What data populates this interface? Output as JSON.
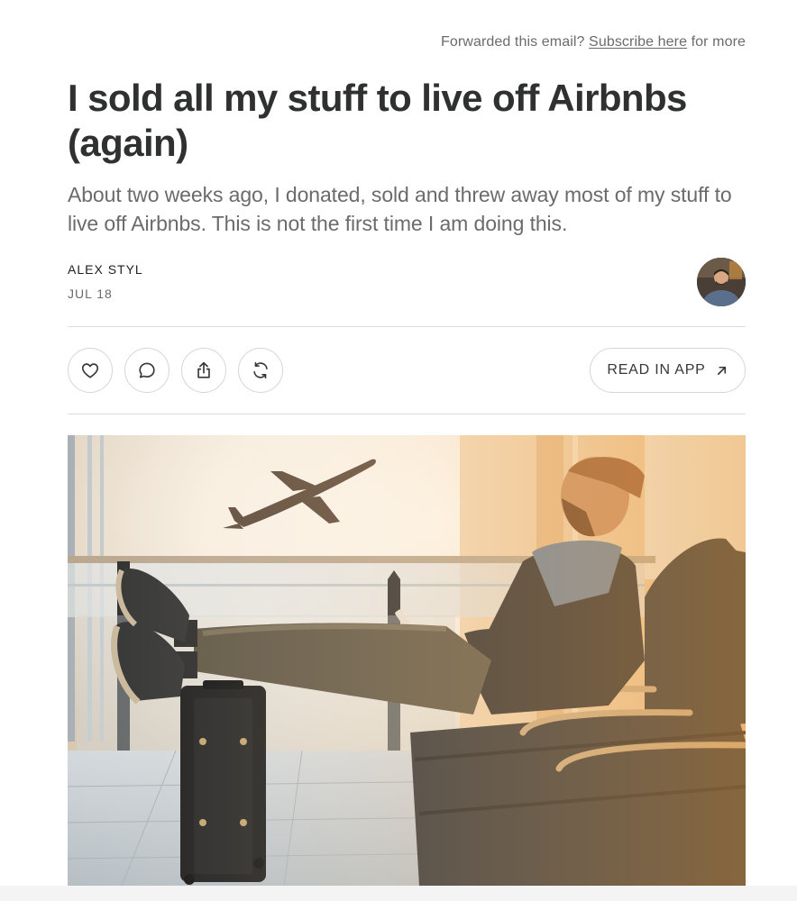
{
  "header": {
    "forward_prefix": "Forwarded this email?",
    "subscribe_link": "Subscribe here",
    "forward_suffix": "for more"
  },
  "post": {
    "title": "I sold all my stuff to live off Airbnbs (again)",
    "subtitle": "About two weeks ago, I donated, sold and threw away most of my stuff to live off Airbnbs. This is not the first time I am doing this.",
    "author": "ALEX STYL",
    "date": "JUL 18"
  },
  "actions": {
    "like_icon": "heart-icon",
    "comment_icon": "comment-icon",
    "share_icon": "share-icon",
    "restack_icon": "restack-icon",
    "read_in_app_label": "READ IN APP",
    "read_in_app_icon": "arrow-up-right-icon"
  },
  "hero_image": {
    "subject": "man-at-airport-gate-with-feet-on-suitcase-watching-plane"
  },
  "colors": {
    "text": "#363737",
    "muted": "#6b6b6b",
    "border": "#d6d6d6"
  }
}
